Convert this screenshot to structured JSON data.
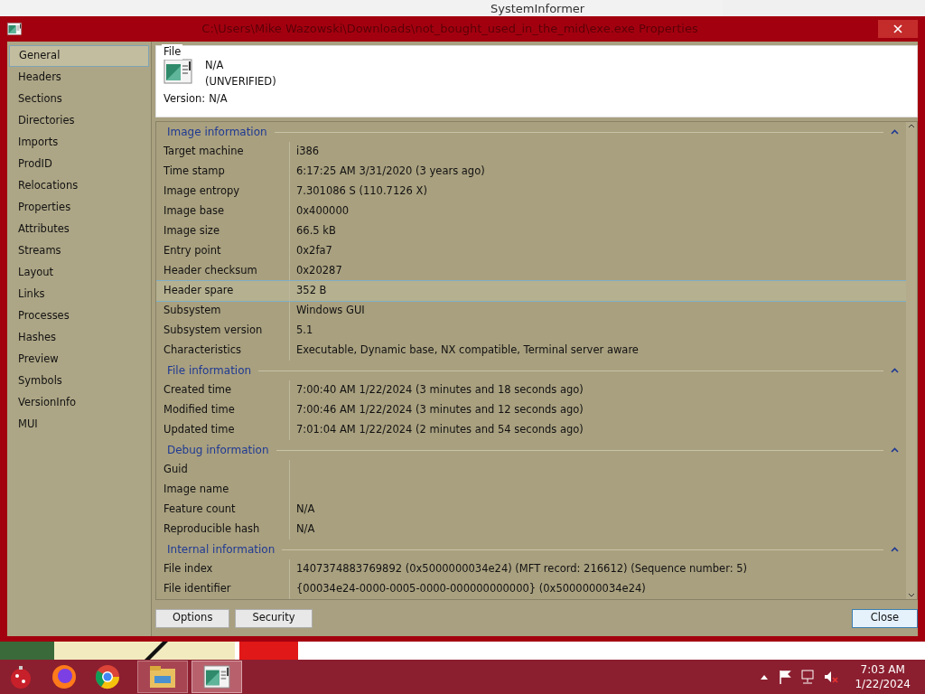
{
  "background_window": {
    "title": "SystemInformer"
  },
  "window": {
    "title": "C:\\Users\\Mike Wazowski\\Downloads\\not_bought_used_in_the_mid\\exe.exe Properties"
  },
  "sidebar": {
    "items": [
      {
        "label": "General",
        "selected": true
      },
      {
        "label": "Headers",
        "selected": false
      },
      {
        "label": "Sections",
        "selected": false
      },
      {
        "label": "Directories",
        "selected": false
      },
      {
        "label": "Imports",
        "selected": false
      },
      {
        "label": "ProdID",
        "selected": false
      },
      {
        "label": "Relocations",
        "selected": false
      },
      {
        "label": "Properties",
        "selected": false
      },
      {
        "label": "Attributes",
        "selected": false
      },
      {
        "label": "Streams",
        "selected": false
      },
      {
        "label": "Layout",
        "selected": false
      },
      {
        "label": "Links",
        "selected": false
      },
      {
        "label": "Processes",
        "selected": false
      },
      {
        "label": "Hashes",
        "selected": false
      },
      {
        "label": "Preview",
        "selected": false
      },
      {
        "label": "Symbols",
        "selected": false
      },
      {
        "label": "VersionInfo",
        "selected": false
      },
      {
        "label": "MUI",
        "selected": false
      }
    ]
  },
  "file": {
    "group_label": "File",
    "name": "N/A",
    "status": "(UNVERIFIED)",
    "version_label": "Version:",
    "version": "N/A"
  },
  "sections": [
    {
      "title": "Image information",
      "expanded": true,
      "rows": [
        {
          "name": "Target machine",
          "value": "i386",
          "selected": false
        },
        {
          "name": "Time stamp",
          "value": "6:17:25 AM 3/31/2020 (3 years ago)",
          "selected": false
        },
        {
          "name": "Image entropy",
          "value": "7.301086 S (110.7126 X)",
          "selected": false
        },
        {
          "name": "Image base",
          "value": "0x400000",
          "selected": false
        },
        {
          "name": "Image size",
          "value": "66.5 kB",
          "selected": false
        },
        {
          "name": "Entry point",
          "value": "0x2fa7",
          "selected": false
        },
        {
          "name": "Header checksum",
          "value": "0x20287",
          "selected": false
        },
        {
          "name": "Header spare",
          "value": "352 B",
          "selected": true
        },
        {
          "name": "Subsystem",
          "value": "Windows GUI",
          "selected": false
        },
        {
          "name": "Subsystem version",
          "value": "5.1",
          "selected": false
        },
        {
          "name": "Characteristics",
          "value": "Executable, Dynamic base, NX compatible, Terminal server aware",
          "selected": false
        }
      ]
    },
    {
      "title": "File information",
      "expanded": true,
      "rows": [
        {
          "name": "Created time",
          "value": "7:00:40 AM 1/22/2024 (3 minutes and 18 seconds ago)",
          "selected": false
        },
        {
          "name": "Modified time",
          "value": "7:00:46 AM 1/22/2024 (3 minutes and 12 seconds ago)",
          "selected": false
        },
        {
          "name": "Updated time",
          "value": "7:01:04 AM 1/22/2024 (2 minutes and 54 seconds ago)",
          "selected": false
        }
      ]
    },
    {
      "title": "Debug information",
      "expanded": true,
      "rows": [
        {
          "name": "Guid",
          "selected": false
        },
        {
          "name": "Image name",
          "selected": false
        },
        {
          "name": "Feature count",
          "value": "N/A",
          "selected": false
        },
        {
          "name": "Reproducible hash",
          "value": "N/A",
          "selected": false
        }
      ]
    },
    {
      "title": "Internal information",
      "expanded": true,
      "rows": [
        {
          "name": "File index",
          "value": "1407374883769892 (0x5000000034e24) (MFT record: 216612) (Sequence number: 5)",
          "selected": false
        },
        {
          "name": "File identifier",
          "value": "{00034e24-0000-0005-0000-000000000000} (0x5000000034e24)",
          "selected": false
        }
      ]
    }
  ],
  "buttons": [
    {
      "label": "Options",
      "kind": "left"
    },
    {
      "label": "Security",
      "kind": "left"
    },
    {
      "label": "Close",
      "kind": "right"
    }
  ],
  "taskbar": {
    "time": "7:03 AM",
    "date": "1/22/2024"
  }
}
